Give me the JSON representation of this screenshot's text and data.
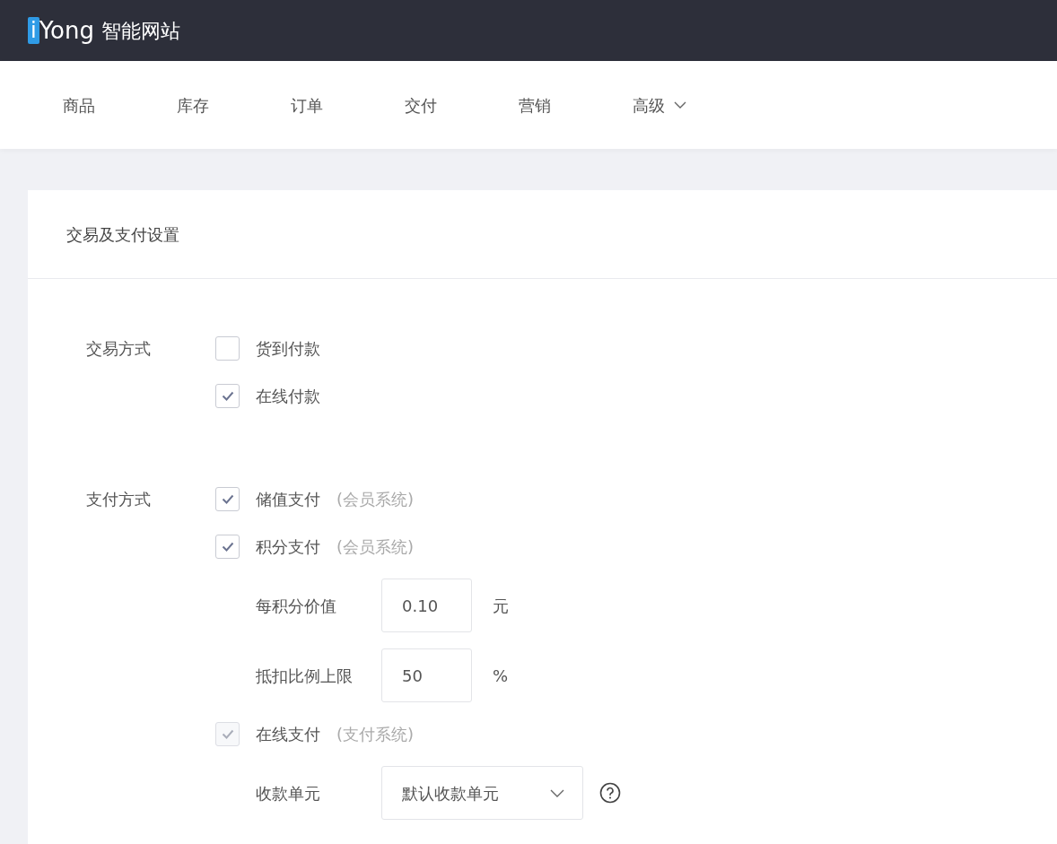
{
  "logo": {
    "mark": "i",
    "name": "Yong",
    "subtitle": "智能网站"
  },
  "nav": [
    {
      "label": "商品",
      "dropdown": false
    },
    {
      "label": "库存",
      "dropdown": false
    },
    {
      "label": "订单",
      "dropdown": false
    },
    {
      "label": "交付",
      "dropdown": false
    },
    {
      "label": "营销",
      "dropdown": false
    },
    {
      "label": "高级",
      "dropdown": true
    }
  ],
  "card": {
    "title": "交易及支付设置",
    "sections": [
      {
        "label": "交易方式",
        "options": [
          {
            "kind": "checkbox",
            "label": "货到付款",
            "checked": false,
            "disabled": false
          },
          {
            "kind": "checkbox",
            "label": "在线付款",
            "checked": true,
            "disabled": false
          }
        ]
      },
      {
        "label": "支付方式",
        "options": [
          {
            "kind": "checkbox",
            "label": "储值支付",
            "note": "(会员系统)",
            "checked": true,
            "disabled": false
          },
          {
            "kind": "checkbox",
            "label": "积分支付",
            "note": "(会员系统)",
            "checked": true,
            "disabled": false
          },
          {
            "kind": "field",
            "label": "每积分价值",
            "value": "0.10",
            "unit": "元"
          },
          {
            "kind": "field",
            "label": "抵扣比例上限",
            "value": "50",
            "unit": "%"
          },
          {
            "kind": "checkbox",
            "label": "在线支付",
            "note": "(支付系统)",
            "checked": true,
            "disabled": true
          },
          {
            "kind": "select",
            "label": "收款单元",
            "value": "默认收款单元",
            "help": true
          }
        ]
      }
    ]
  }
}
